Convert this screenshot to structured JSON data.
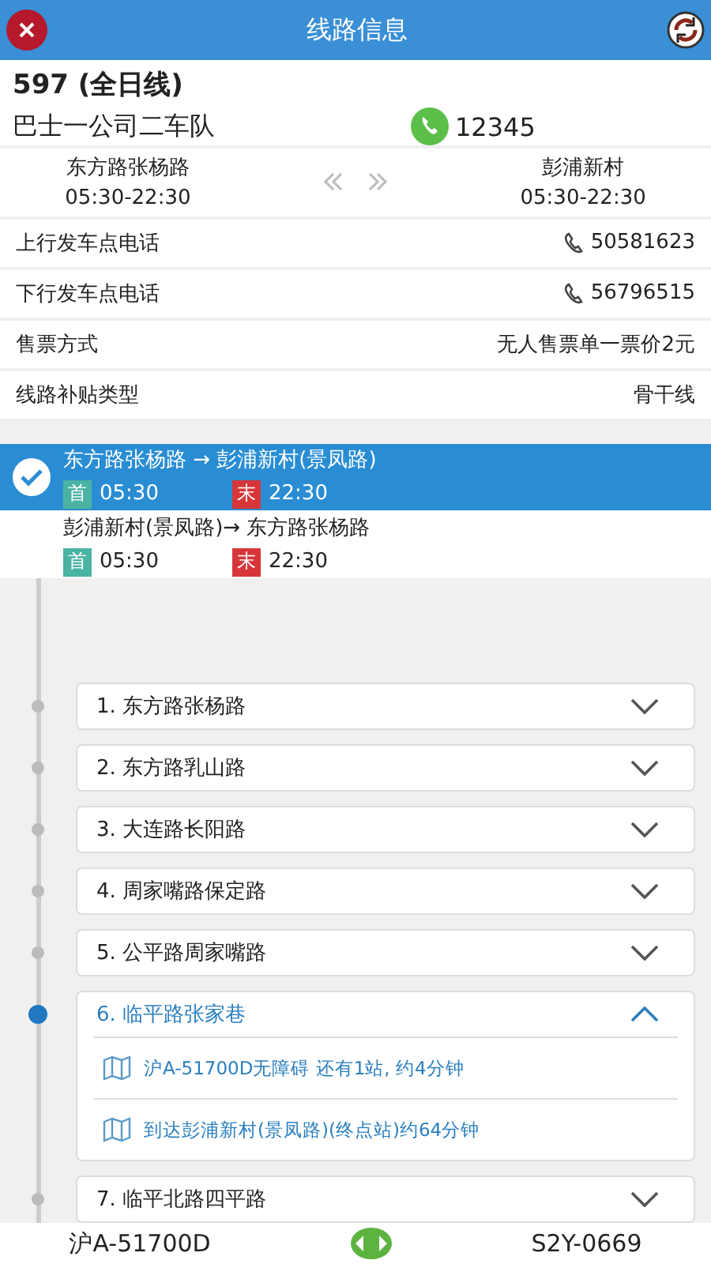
{
  "header": {
    "title": "线路信息"
  },
  "route": {
    "name": "597 (全日线)",
    "company": "巴士一公司二车队",
    "phone": "12345"
  },
  "terminals": [
    {
      "name": "东方路张杨路",
      "hours": "05:30-22:30"
    },
    {
      "name": "彭浦新村",
      "hours": "05:30-22:30"
    }
  ],
  "info_rows": [
    {
      "label": "上行发车点电话",
      "value": "50581623",
      "kind": "phone"
    },
    {
      "label": "下行发车点电话",
      "value": "56796515",
      "kind": "phone"
    },
    {
      "label": "售票方式",
      "value": "无人售票单一票价2元",
      "kind": "text"
    },
    {
      "label": "线路补贴类型",
      "value": "骨干线",
      "kind": "text"
    }
  ],
  "directions": [
    {
      "route": "东方路张杨路 → 彭浦新村(景凤路)",
      "first_tag": "首",
      "first": "05:30",
      "last_tag": "末",
      "last": "22:30",
      "selected": true
    },
    {
      "route": "彭浦新村(景凤路)→ 东方路张杨路",
      "first_tag": "首",
      "first": "05:30",
      "last_tag": "末",
      "last": "22:30",
      "selected": false
    }
  ],
  "stops": [
    {
      "name": "1. 东方路张杨路",
      "expanded": false,
      "current": false
    },
    {
      "name": "2. 东方路乳山路",
      "expanded": false,
      "current": false
    },
    {
      "name": "3. 大连路长阳路",
      "expanded": false,
      "current": false
    },
    {
      "name": "4. 周家嘴路保定路",
      "expanded": false,
      "current": false
    },
    {
      "name": "5. 公平路周家嘴路",
      "expanded": false,
      "current": false
    },
    {
      "name": "6. 临平路张家巷",
      "expanded": true,
      "current": true,
      "details": [
        "沪A-51700D无障碍 还有1站, 约4分钟",
        "到达彭浦新村(景凤路)(终点站)约64分钟"
      ]
    },
    {
      "name": "7. 临平北路四平路",
      "expanded": false,
      "current": false
    }
  ],
  "bottom_bar": {
    "left_plate": "沪A-51700D",
    "right_plate": "S2Y-0669"
  }
}
